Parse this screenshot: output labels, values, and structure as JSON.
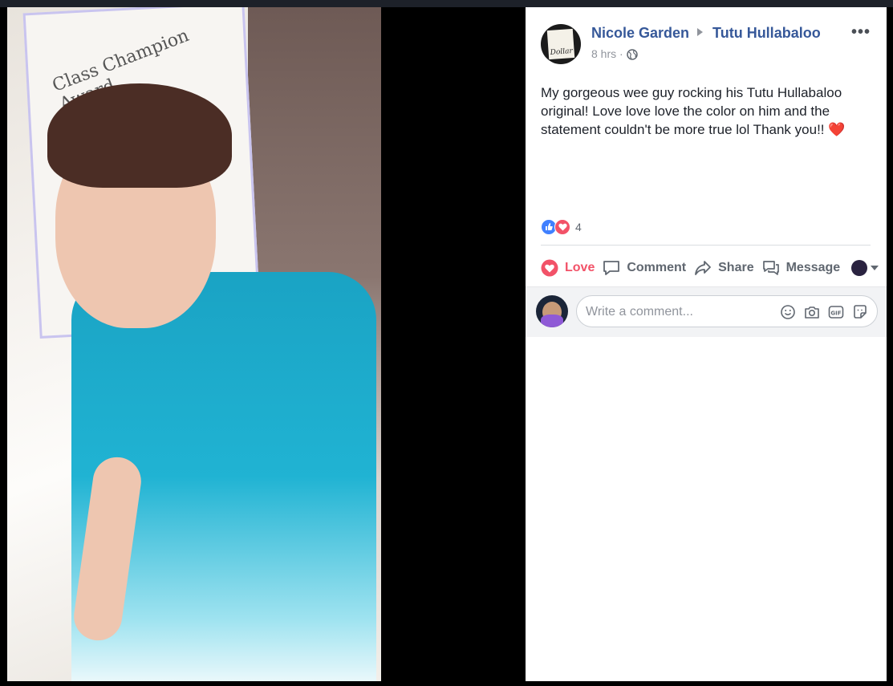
{
  "post": {
    "author": "Nicole Garden",
    "target": "Tutu Hullabaloo",
    "time": "8 hrs",
    "separator": "·",
    "more": "•••",
    "text": "My gorgeous wee guy rocking his Tutu Hullabaloo original! Love love love the color on him and the statement couldn't be more true lol Thank you!!",
    "text_emoji": "❤️",
    "reaction_count": "4",
    "avatar_sign_text": "Dollar"
  },
  "photo": {
    "poster_text": "Class Champion Award"
  },
  "actions": {
    "love": "Love",
    "comment": "Comment",
    "share": "Share",
    "message": "Message"
  },
  "comment_box": {
    "placeholder": "Write a comment..."
  },
  "colors": {
    "link": "#365899",
    "love": "#f25268",
    "like": "#4080ff"
  },
  "icons": [
    "globe-icon",
    "like-reaction-icon",
    "love-reaction-icon",
    "heart-icon",
    "comment-icon",
    "share-icon",
    "message-icon",
    "emoji-icon",
    "camera-icon",
    "gif-icon",
    "sticker-icon"
  ]
}
